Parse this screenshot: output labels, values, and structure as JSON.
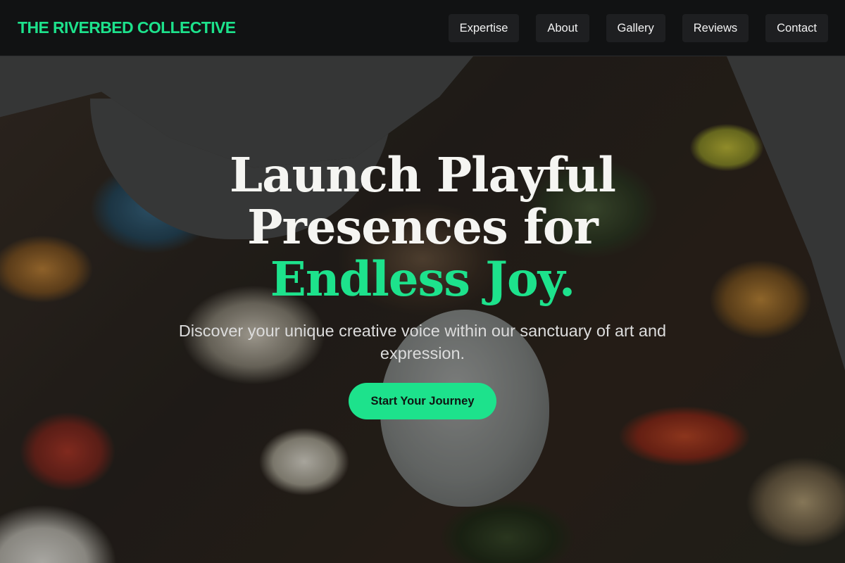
{
  "brand": {
    "name": "THE RIVERBED COLLECTIVE"
  },
  "nav": {
    "items": [
      {
        "label": "Expertise"
      },
      {
        "label": "About"
      },
      {
        "label": "Gallery"
      },
      {
        "label": "Reviews"
      },
      {
        "label": "Contact"
      }
    ]
  },
  "hero": {
    "title_plain": "Launch Playful Presences for ",
    "title_accent": "Endless Joy.",
    "subtitle": "Discover your unique creative voice within our sanctuary of art and expression.",
    "cta_label": "Start Your Journey"
  },
  "colors": {
    "accent": "#1de28c",
    "header_bg": "#0f1011",
    "nav_button_bg": "#1e1f21"
  }
}
